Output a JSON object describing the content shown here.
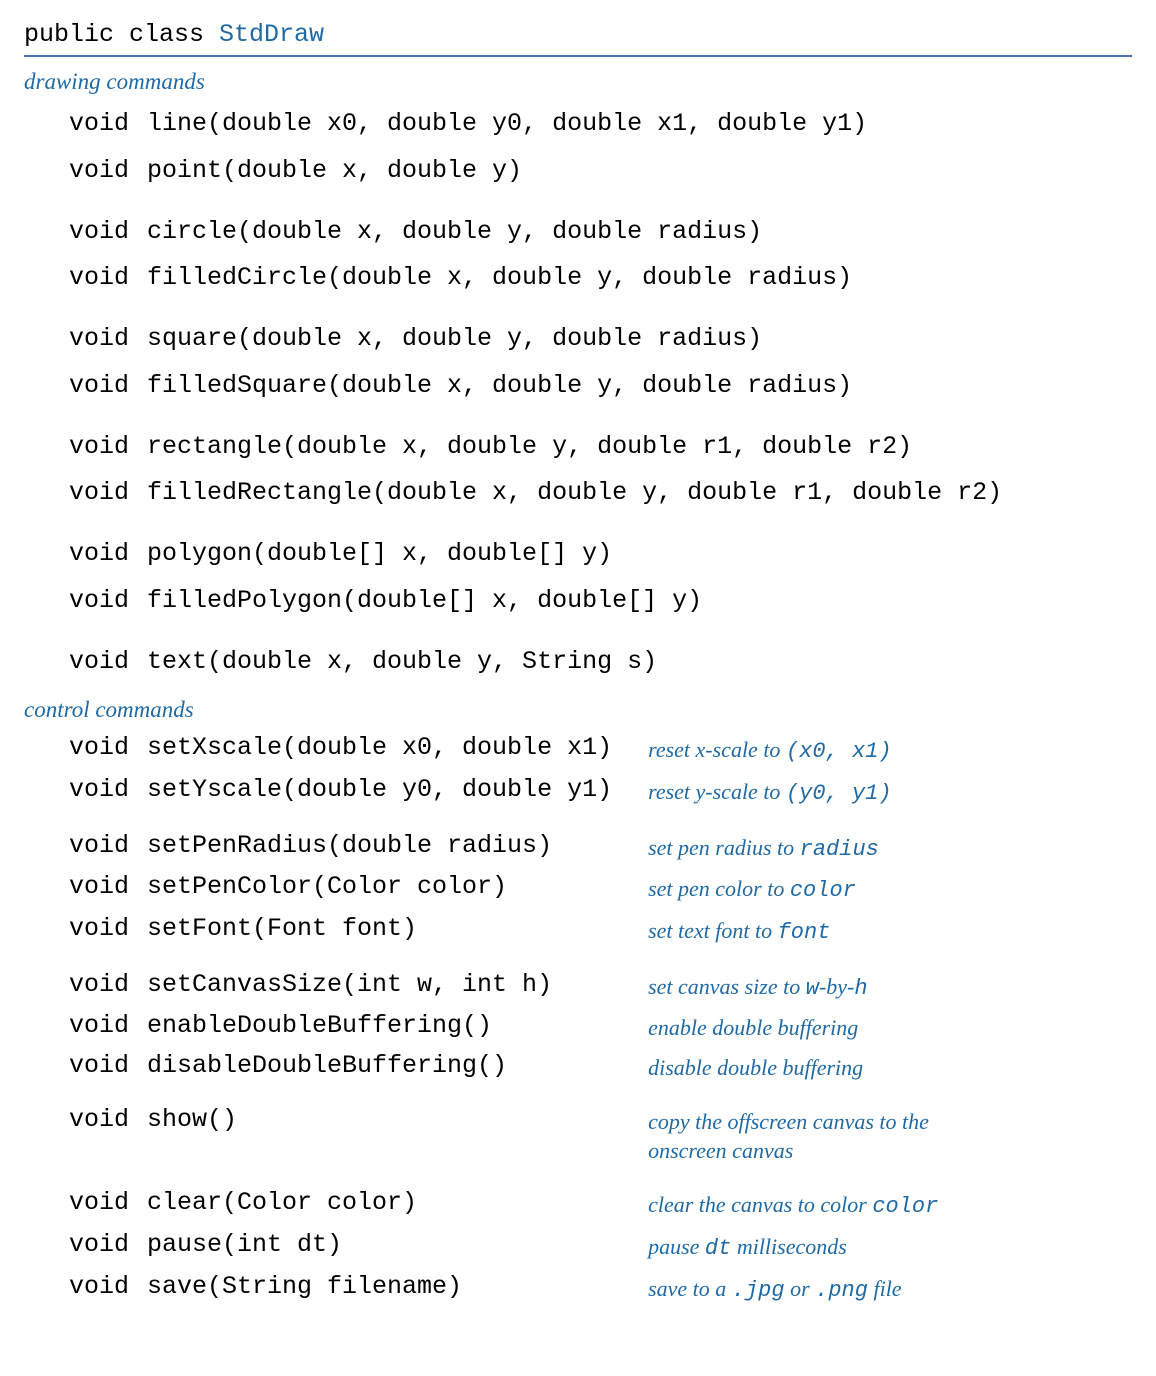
{
  "class_header": {
    "prefix": "public class ",
    "name": "StdDraw"
  },
  "sections": {
    "drawing_label": "drawing commands",
    "control_label": "control commands"
  },
  "drawing": [
    {
      "ret": "void",
      "sig": "line(double x0, double y0, double x1, double y1)"
    },
    {
      "ret": "void",
      "sig": "point(double x, double y)"
    },
    {
      "gap": true
    },
    {
      "ret": "void",
      "sig": "circle(double x, double y, double radius)"
    },
    {
      "ret": "void",
      "sig": "filledCircle(double x, double y, double radius)"
    },
    {
      "gap": true
    },
    {
      "ret": "void",
      "sig": "square(double x, double y, double radius)"
    },
    {
      "ret": "void",
      "sig": "filledSquare(double x, double y, double radius)"
    },
    {
      "gap": true
    },
    {
      "ret": "void",
      "sig": "rectangle(double x, double y, double r1, double r2)"
    },
    {
      "ret": "void",
      "sig": "filledRectangle(double x, double y, double r1, double r2)"
    },
    {
      "gap": true
    },
    {
      "ret": "void",
      "sig": "polygon(double[] x, double[] y)"
    },
    {
      "ret": "void",
      "sig": "filledPolygon(double[] x, double[] y)"
    },
    {
      "gap": true
    },
    {
      "ret": "void",
      "sig": "text(double x, double y, String s)"
    }
  ],
  "control": [
    {
      "ret": "void",
      "sig": "setXscale(double x0, double x1)",
      "desc": [
        {
          "t": "reset x-scale to "
        },
        {
          "m": "(x0, x1)"
        }
      ]
    },
    {
      "ret": "void",
      "sig": "setYscale(double y0, double y1)",
      "desc": [
        {
          "t": "reset y-scale to "
        },
        {
          "m": "(y0, y1)"
        }
      ]
    },
    {
      "gap": true
    },
    {
      "ret": "void",
      "sig": "setPenRadius(double radius)",
      "desc": [
        {
          "t": "set pen radius to "
        },
        {
          "m": "radius"
        }
      ]
    },
    {
      "ret": "void",
      "sig": "setPenColor(Color color)",
      "desc": [
        {
          "t": "set pen color to "
        },
        {
          "m": "color"
        }
      ]
    },
    {
      "ret": "void",
      "sig": "setFont(Font font)",
      "desc": [
        {
          "t": "set text font to "
        },
        {
          "m": "font"
        }
      ]
    },
    {
      "gap": true
    },
    {
      "ret": "void",
      "sig": "setCanvasSize(int w, int h)",
      "desc": [
        {
          "t": "set canvas size to "
        },
        {
          "m": "w"
        },
        {
          "t": "-by-"
        },
        {
          "m": "h"
        }
      ]
    },
    {
      "ret": "void",
      "sig": "enableDoubleBuffering()",
      "desc": [
        {
          "t": "enable double buffering"
        }
      ]
    },
    {
      "ret": "void",
      "sig": "disableDoubleBuffering()",
      "desc": [
        {
          "t": "disable double buffering"
        }
      ]
    },
    {
      "gap": true
    },
    {
      "ret": "void",
      "sig": "show()",
      "desc": [
        {
          "t": "copy the offscreen canvas to the onscreen canvas"
        }
      ]
    },
    {
      "gap": true
    },
    {
      "ret": "void",
      "sig": "clear(Color color)",
      "desc": [
        {
          "t": "clear the canvas to color "
        },
        {
          "m": "color"
        }
      ]
    },
    {
      "ret": "void",
      "sig": "pause(int dt)",
      "desc": [
        {
          "t": "pause "
        },
        {
          "m": "dt"
        },
        {
          "t": " milliseconds"
        }
      ]
    },
    {
      "ret": "void",
      "sig": "save(String filename)",
      "desc": [
        {
          "t": "save to a "
        },
        {
          "m": ".jpg"
        },
        {
          "t": " or "
        },
        {
          "m": ".png"
        },
        {
          "t": " file"
        }
      ]
    }
  ]
}
